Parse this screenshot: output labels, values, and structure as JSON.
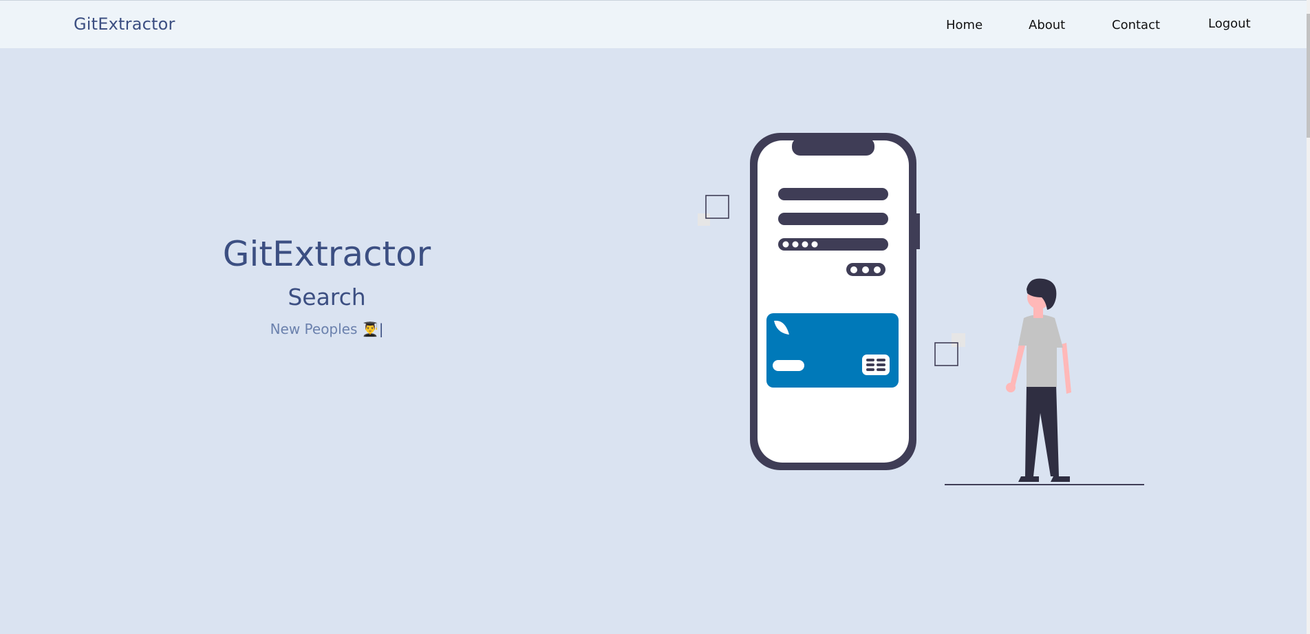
{
  "navbar": {
    "brand": "GitExtractor",
    "links": [
      "Home",
      "About",
      "Contact",
      "Logout"
    ]
  },
  "hero": {
    "title": "GitExtractor",
    "subtitle": "Search",
    "typed_text": "New Peoples",
    "typed_emoji": "👨‍🎓",
    "caret": "|"
  },
  "colors": {
    "page_background": "#dae3f1",
    "navbar_background": "#eef4f9",
    "brand_text": "#3c4f82",
    "accent_card": "#0079b9",
    "phone_dark": "#3f3d56"
  },
  "illustration": {
    "icon": "phone-payment-illustration"
  }
}
